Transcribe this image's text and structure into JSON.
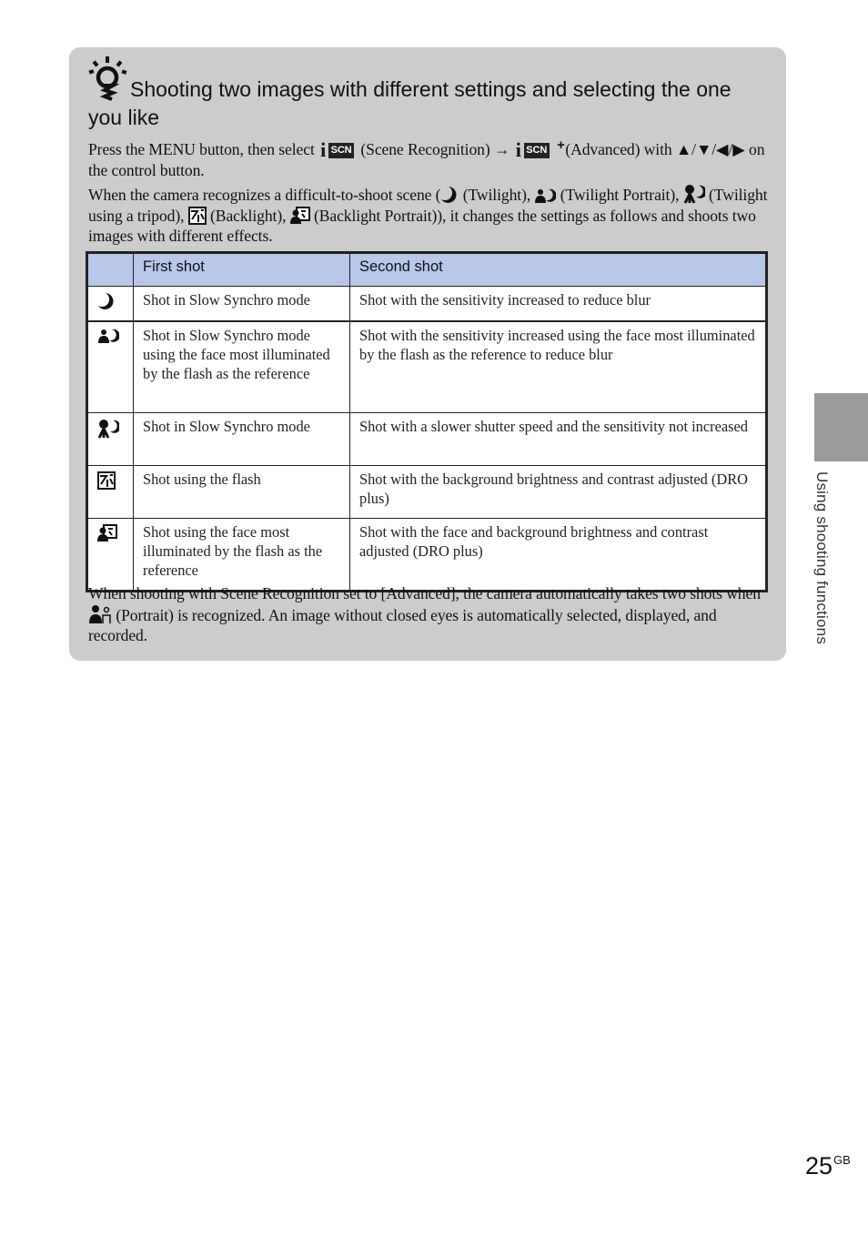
{
  "tip": {
    "icon": "lightbulb-hint-icon",
    "title": "Shooting two images with different settings and selecting the one you like",
    "paragraph1": {
      "t1": "Press the MENU button, then select",
      "scn_label": "SCN",
      "t2": "(Scene Recognition)",
      "arrow": "→",
      "t3": "(Advanced) with ▲/▼/◀/▶ on the control button."
    },
    "paragraph2": {
      "t1": "When the camera recognizes a difficult-to-shoot scene (",
      "twilight": "(Twilight),",
      "twilight_portrait": "(Twilight Portrait),",
      "twilight_tripod": "(Twilight using a tripod),",
      "backlight": "(Backlight),",
      "backlight_portrait": "(Backlight Portrait)), it changes the settings as follows and shoots two images with different effects."
    },
    "table": {
      "headers": [
        "",
        "First shot",
        "Second shot"
      ],
      "rows": [
        {
          "icon": "twilight-icon",
          "first": "Shot in Slow Synchro mode",
          "second": "Shot with the sensitivity increased to reduce blur"
        },
        {
          "icon": "twilight-portrait-icon",
          "first": "Shot in Slow Synchro mode using the face most illuminated by the flash as the reference",
          "second": "Shot with the sensitivity increased using the face most illuminated by the flash as the reference to reduce blur"
        },
        {
          "icon": "twilight-tripod-icon",
          "first": "Shot in Slow Synchro mode",
          "second": "Shot with a slower shutter speed and the sensitivity not increased"
        },
        {
          "icon": "backlight-icon",
          "first": "Shot using the flash",
          "second": "Shot with the background brightness and contrast adjusted (DRO plus)"
        },
        {
          "icon": "backlight-portrait-icon",
          "first": "Shot using the face most illuminated by the flash as the reference",
          "second": "Shot with the face and background brightness and contrast adjusted (DRO plus)"
        }
      ]
    },
    "paragraph3": {
      "t1": "When shooting with Scene Recognition set to [Advanced], the camera automatically takes two shots when",
      "t2": "(Portrait) is recognized. An image without closed eyes is automatically selected, displayed, and recorded."
    }
  },
  "side_section_label": "Using shooting functions",
  "page": {
    "number": "25",
    "suffix": "GB"
  },
  "colors": {
    "box_bg": "#cccccc",
    "table_header_bg": "#b8c7ea",
    "side_tab": "#9a9a9a"
  }
}
